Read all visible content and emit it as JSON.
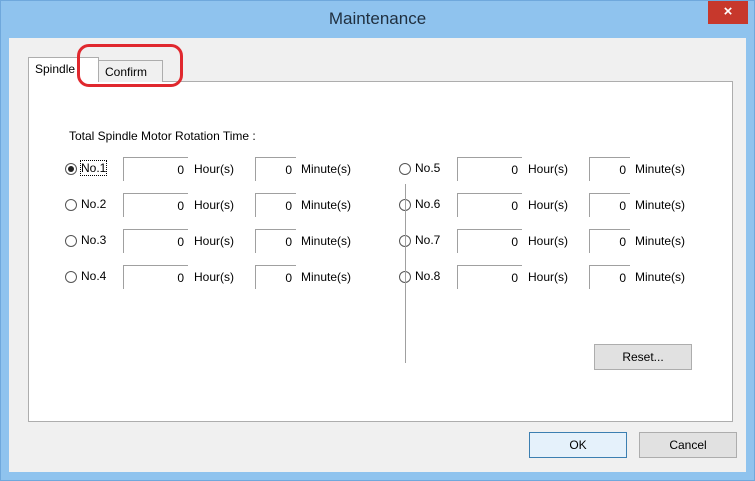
{
  "window": {
    "title": "Maintenance",
    "close_glyph": "×"
  },
  "tabs": [
    {
      "label": "Spindle",
      "active": true
    },
    {
      "label": "Confirm",
      "active": false
    }
  ],
  "panel_title": "Total Spindle Motor Rotation Time :",
  "units": {
    "hours": "Hour(s)",
    "minutes": "Minute(s)"
  },
  "spindles": [
    {
      "label": "No.1",
      "hours": "0",
      "minutes": "0",
      "selected": true
    },
    {
      "label": "No.2",
      "hours": "0",
      "minutes": "0",
      "selected": false
    },
    {
      "label": "No.3",
      "hours": "0",
      "minutes": "0",
      "selected": false
    },
    {
      "label": "No.4",
      "hours": "0",
      "minutes": "0",
      "selected": false
    },
    {
      "label": "No.5",
      "hours": "0",
      "minutes": "0",
      "selected": false
    },
    {
      "label": "No.6",
      "hours": "0",
      "minutes": "0",
      "selected": false
    },
    {
      "label": "No.7",
      "hours": "0",
      "minutes": "0",
      "selected": false
    },
    {
      "label": "No.8",
      "hours": "0",
      "minutes": "0",
      "selected": false
    }
  ],
  "buttons": {
    "reset": "Reset...",
    "ok": "OK",
    "cancel": "Cancel"
  },
  "colors": {
    "titlebar": "#8fc3ee",
    "close": "#c7382c",
    "highlight": "#e0282e"
  }
}
